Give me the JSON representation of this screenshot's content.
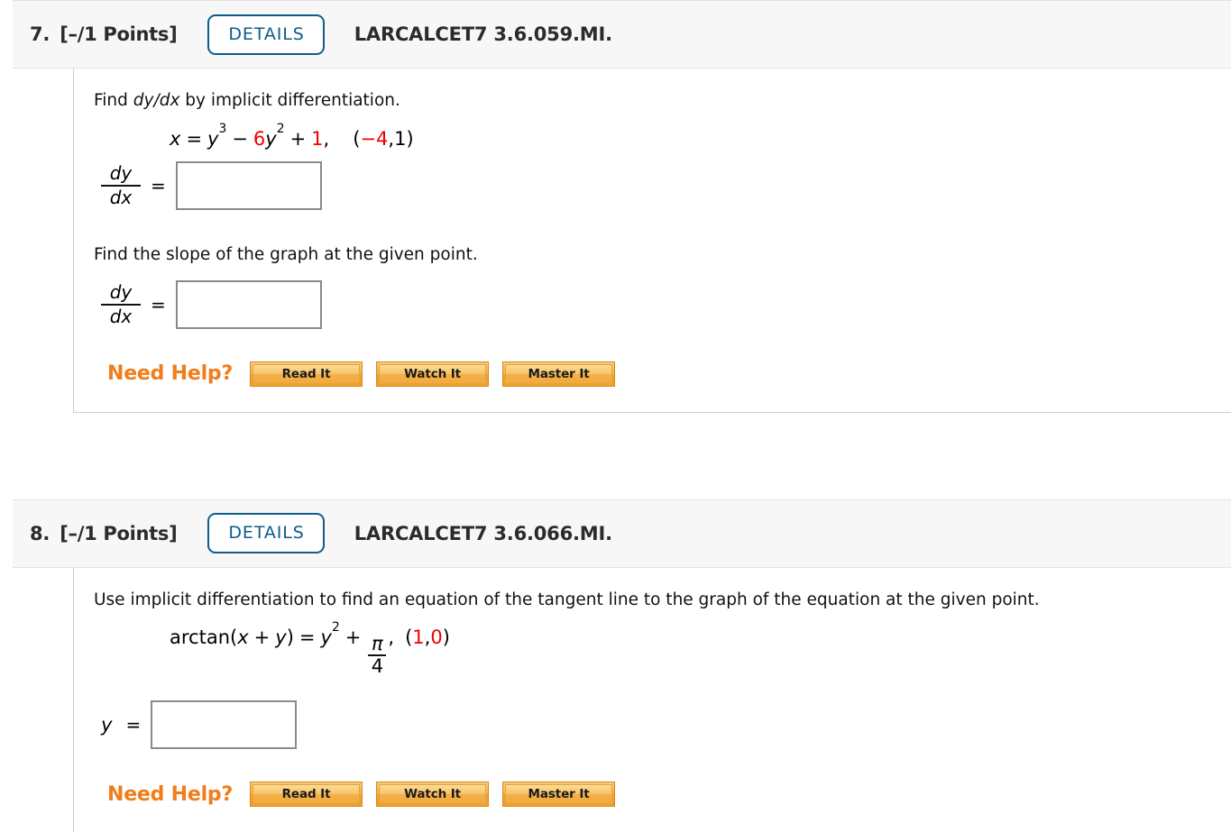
{
  "problems": [
    {
      "number": "7.",
      "points": "[–/1 Points]",
      "details_label": "DETAILS",
      "code": "LARCALCET7 3.6.059.MI.",
      "prompt1": "Find dy/dx by implicit differentiation.",
      "prompt1_pre": "Find ",
      "prompt1_mid": "dy/dx",
      "prompt1_post": " by implicit differentiation.",
      "equation": {
        "lhs_var": "x",
        "eq": "=",
        "term1_base": "y",
        "term1_exp": "3",
        "minus": "−",
        "term2_coef": "6",
        "term2_base": "y",
        "term2_exp": "2",
        "plus": "+",
        "term3": "1",
        "comma": ",",
        "point_open": "(",
        "point_x": "−4",
        "point_sep": ", ",
        "point_y": "1",
        "point_close": ")"
      },
      "answer1": {
        "num": "dy",
        "den": "dx",
        "equals": "=",
        "value": "",
        "placeholder": ""
      },
      "prompt2": "Find the slope of the graph at the given point.",
      "answer2": {
        "num": "dy",
        "den": "dx",
        "equals": "=",
        "value": "",
        "placeholder": ""
      },
      "need_help": {
        "label": "Need Help?",
        "buttons": [
          "Read It",
          "Watch It",
          "Master It"
        ]
      }
    },
    {
      "number": "8.",
      "points": "[–/1 Points]",
      "details_label": "DETAILS",
      "code": "LARCALCET7 3.6.066.MI.",
      "prompt1": "Use implicit differentiation to find an equation of the tangent line to the graph of the equation at the given point.",
      "equation": {
        "fn": "arctan(",
        "arg_x": "x",
        "arg_plus": "+",
        "arg_y": "y",
        "fn_close": ")",
        "eq": "=",
        "rhs_base": "y",
        "rhs_exp": "2",
        "plus": "+",
        "frac_num": "π",
        "frac_den": "4",
        "comma": ",",
        "point_open": "(",
        "point_x": "1",
        "point_sep": ", ",
        "point_y": "0",
        "point_close": ")"
      },
      "answer1": {
        "label": "y",
        "equals": "=",
        "value": "",
        "placeholder": ""
      },
      "need_help": {
        "label": "Need Help?",
        "buttons": [
          "Read It",
          "Watch It",
          "Master It"
        ]
      }
    }
  ],
  "colors": {
    "accent_blue": "#0d5c8c",
    "red": "#ee0000",
    "orange": "#f07d1a",
    "header_bg": "#f7f7f7",
    "border_gray": "#cfcfcf"
  }
}
